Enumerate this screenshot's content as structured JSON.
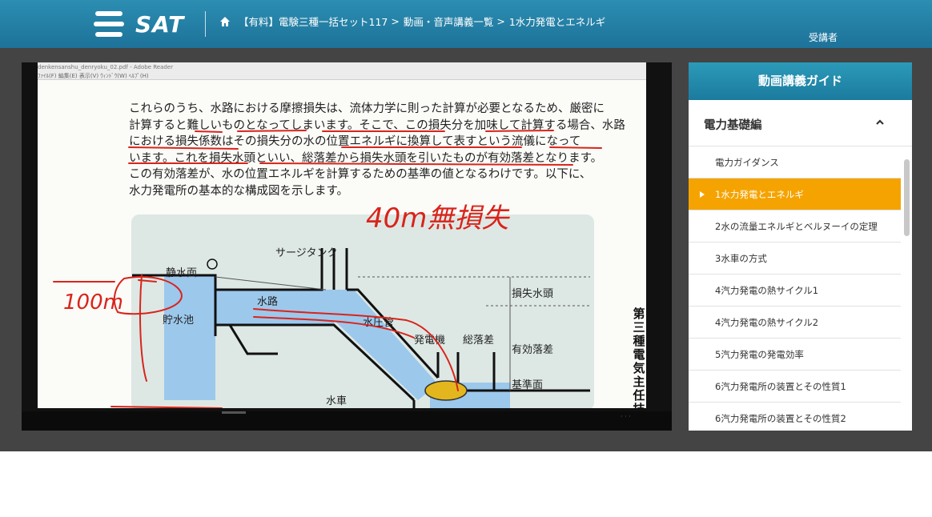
{
  "header": {
    "logo_text": "SAT",
    "breadcrumb": [
      "【有料】電験三種一括セット117",
      "動画・音声講義一覧",
      "1水力発電とエネルギ"
    ],
    "separator": ">",
    "user_label": "受講者",
    "colors": {
      "bar": "#1f7aa1",
      "text": "#ffffff"
    }
  },
  "video": {
    "reader_title": "denkensanshu_denryoku_02.pdf - Adobe Reader",
    "reader_menu": "ﾌｧｲﾙ(F)  編集(E)  表示(V)  ｳｨﾝﾄﾞｳ(W)  ﾍﾙﾌﾟ(H)",
    "doc_lines": [
      "これらのうち、水路における摩擦損失は、流体力学に則った計算が必要となるため、厳密に",
      "計算すると難しいものとなってしまいます。そこで、この損失分を加味して計算する場合、水路",
      "における損失係数はその損失分の水の位置エネルギに換算して表すという流儀になって",
      "います。これを損失水頭といい、総落差から損失水頭を引いたものが有効落差となります。",
      "この有効落差が、水の位置エネルギを計算するための基準の値となるわけです。以下に、",
      "水力発電所の基本的な構成図を示します。"
    ],
    "handwriting": {
      "note_top": "40m無損失",
      "note_left": "100m"
    },
    "diagram_labels": {
      "surge_tank": "サージタンク",
      "still_water": "静水面",
      "waterway": "水路",
      "reservoir": "貯水池",
      "penstock": "水圧管",
      "generator": "発電機",
      "gross_head": "総落差",
      "head_loss": "損失水頭",
      "effective_head": "有効落差",
      "datum": "基準面",
      "turbine": "水車"
    },
    "side_title": "第三種電気主任技術",
    "scrub_dots": "· · ·"
  },
  "sidebar": {
    "title": "動画講義ガイド",
    "section": "電力基礎編",
    "active_index": 1,
    "items": [
      "電力ガイダンス",
      "1水力発電とエネルギ",
      "2水の流量エネルギとベルヌーイの定理",
      "3水車の方式",
      "4汽力発電の熱サイクル1",
      "4汽力発電の熱サイクル2",
      "5汽力発電の発電効率",
      "6汽力発電所の装置とその性質1",
      "6汽力発電所の装置とその性質2"
    ],
    "colors": {
      "active": "#f5a300",
      "header": "#1f88ab"
    }
  }
}
